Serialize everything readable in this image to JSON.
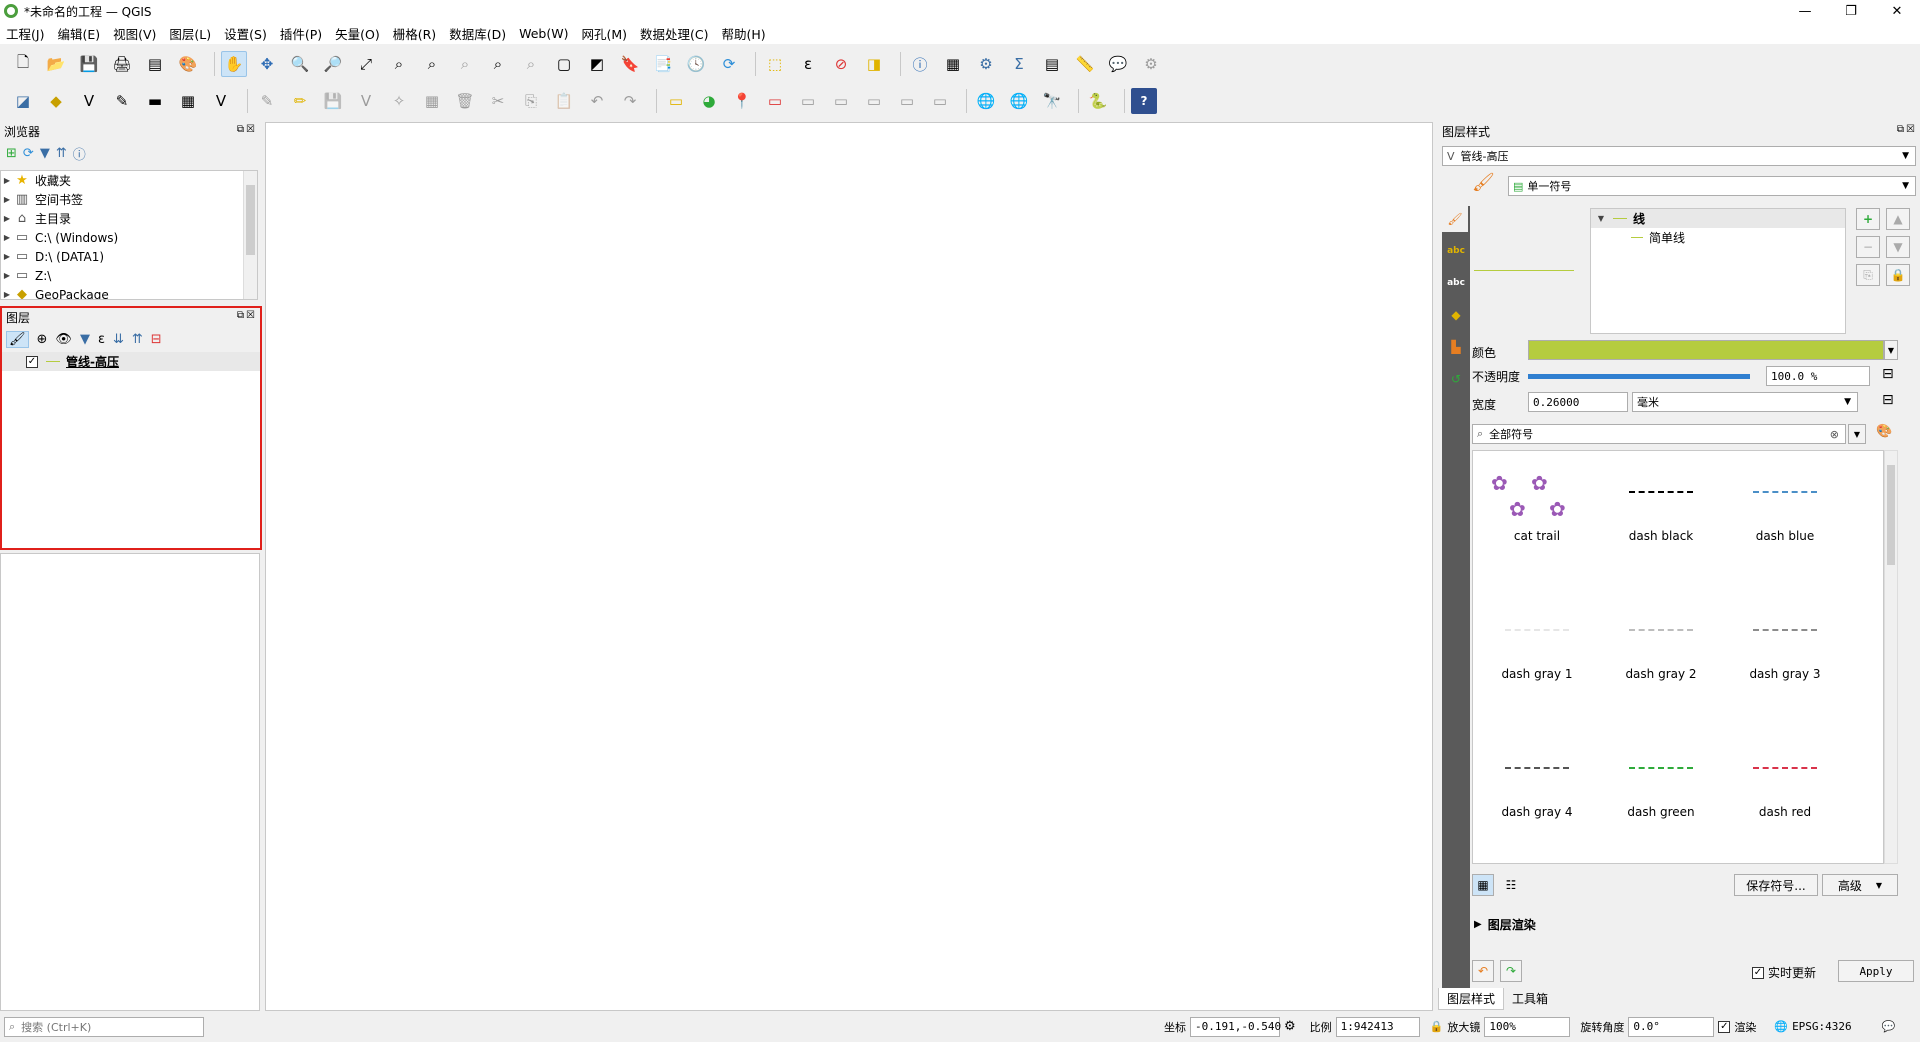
{
  "window": {
    "title": "*未命名的工程 — QGIS",
    "minimize": "—",
    "maximize": "❐",
    "close": "✕"
  },
  "menu": [
    "工程(J)",
    "编辑(E)",
    "视图(V)",
    "图层(L)",
    "设置(S)",
    "插件(P)",
    "矢量(O)",
    "栅格(R)",
    "数据库(D)",
    "Web(W)",
    "网孔(M)",
    "数据处理(C)",
    "帮助(H)"
  ],
  "browser": {
    "title": "浏览器",
    "items": [
      {
        "label": "收藏夹",
        "icon": "star-icon",
        "glyph": "★",
        "color": "#e8b400"
      },
      {
        "label": "空间书签",
        "icon": "bookmark-icon",
        "glyph": "▥",
        "color": "#555"
      },
      {
        "label": "主目录",
        "icon": "home-folder-icon",
        "glyph": "⌂",
        "color": "#555"
      },
      {
        "label": "C:\\ (Windows)",
        "icon": "drive-icon",
        "glyph": "▭",
        "color": "#555"
      },
      {
        "label": "D:\\ (DATA1)",
        "icon": "drive-icon",
        "glyph": "▭",
        "color": "#555"
      },
      {
        "label": "Z:\\",
        "icon": "drive-icon",
        "glyph": "▭",
        "color": "#555"
      },
      {
        "label": "GeoPackage",
        "icon": "geopackage-icon",
        "glyph": "◆",
        "color": "#c8a000"
      }
    ]
  },
  "layers": {
    "title": "图层",
    "items": [
      {
        "label": "管线-高压",
        "checked": "✓"
      }
    ]
  },
  "layer_style": {
    "title": "图层样式",
    "layer_select": "管线-高压",
    "renderer": "单一符号",
    "tree_root": "线",
    "tree_child": "简单线",
    "color_label": "颜色",
    "color_value": "#b5cc3f",
    "opacity_label": "不透明度",
    "opacity_value": "100.0 %",
    "opacity_fraction": 1.0,
    "width_label": "宽度",
    "width_value": "0.26000",
    "width_unit": "毫米",
    "search_value": "全部符号",
    "symbols": [
      {
        "name": "cat trail",
        "color": "#9b59b6"
      },
      {
        "name": "dash  black",
        "color": "#000000"
      },
      {
        "name": "dash blue",
        "color": "#4a8fc7"
      },
      {
        "name": "dash gray 1",
        "color": "#e6e6e6"
      },
      {
        "name": "dash gray 2",
        "color": "#bdbdbd"
      },
      {
        "name": "dash gray 3",
        "color": "#8c8c8c"
      },
      {
        "name": "dash gray 4",
        "color": "#555555"
      },
      {
        "name": "dash green",
        "color": "#2eaa3a"
      },
      {
        "name": "dash red",
        "color": "#d9334a"
      }
    ],
    "save_symbol": "保存符号...",
    "advanced": "高级",
    "rendering_section": "图层渲染",
    "live_update": "实时更新",
    "apply": "Apply",
    "tab_style": "图层样式",
    "tab_toolbox": "工具箱"
  },
  "statusbar": {
    "search_placeholder": "搜索 (Ctrl+K)",
    "coord_label": "坐标",
    "coord_value": "-0.191,-0.540",
    "scale_label": "比例",
    "scale_value": "1:942413",
    "magnifier_label": "放大镜",
    "magnifier_value": "100%",
    "rotation_label": "旋转角度",
    "rotation_value": "0.0°",
    "render_label": "渲染",
    "crs": "EPSG:4326"
  }
}
